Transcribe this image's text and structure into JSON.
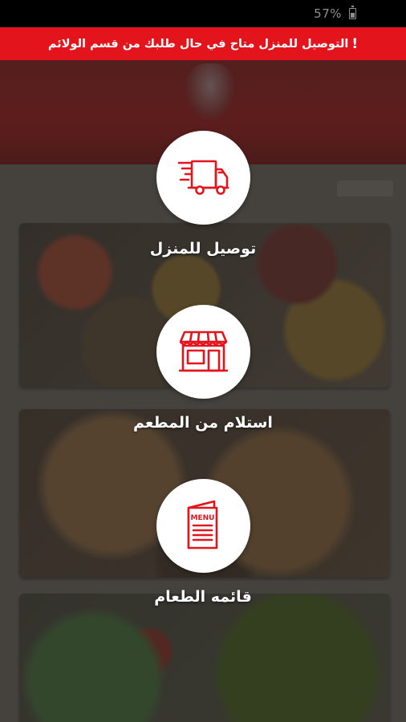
{
  "status_bar": {
    "battery_percent": "57%",
    "battery_icon": "battery-icon"
  },
  "notice": {
    "text": "التوصيل للمنزل متاح في حال طلبك من قسم الولائم",
    "icon": "!"
  },
  "options": [
    {
      "label": "توصيل للمنزل",
      "icon": "delivery-truck-icon"
    },
    {
      "label": "استلام من المطعم",
      "icon": "storefront-icon"
    },
    {
      "label": "قائمه الطعام",
      "icon": "menu-icon",
      "icon_text": "MENU"
    }
  ],
  "colors": {
    "accent": "#e3141c",
    "banner_text": "#ffffff",
    "circle_bg": "#ffffff"
  }
}
